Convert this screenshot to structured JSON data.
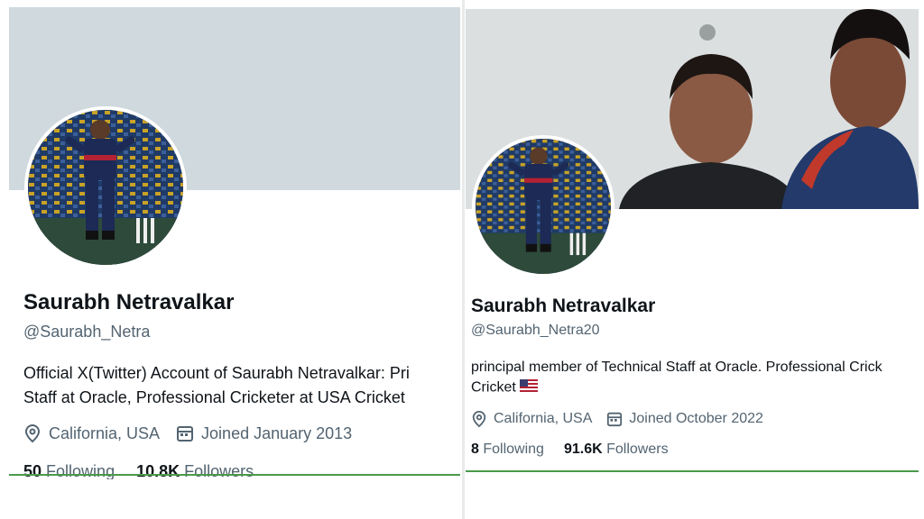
{
  "left_profile": {
    "name": "Saurabh Netravalkar",
    "handle": "@Saurabh_Netra",
    "bio_line1": "Official X(Twitter) Account of Saurabh Netravalkar: Pri",
    "bio_line2": "Staff at Oracle, Professional Cricketer at USA Cricket",
    "location": "California, USA",
    "joined": "Joined January 2013",
    "following_count": "50",
    "following_label": "Following",
    "followers_count": "10.8K",
    "followers_label": "Followers"
  },
  "right_profile": {
    "name": "Saurabh Netravalkar",
    "handle": "@Saurabh_Netra20",
    "bio_line1": "principal member of Technical Staff at Oracle. Professional Crick",
    "bio_line2": "Cricket",
    "location": "California, USA",
    "joined": "Joined October 2022",
    "following_count": "8",
    "following_label": "Following",
    "followers_count": "91.6K",
    "followers_label": "Followers"
  },
  "icons": {
    "location": "location-pin-icon",
    "calendar": "calendar-icon",
    "flag": "us-flag-icon"
  },
  "colors": {
    "primary_text": "#0f1419",
    "secondary_text": "#536471",
    "banner_left": "#cfd9de",
    "underline": "#4a9a4a"
  }
}
